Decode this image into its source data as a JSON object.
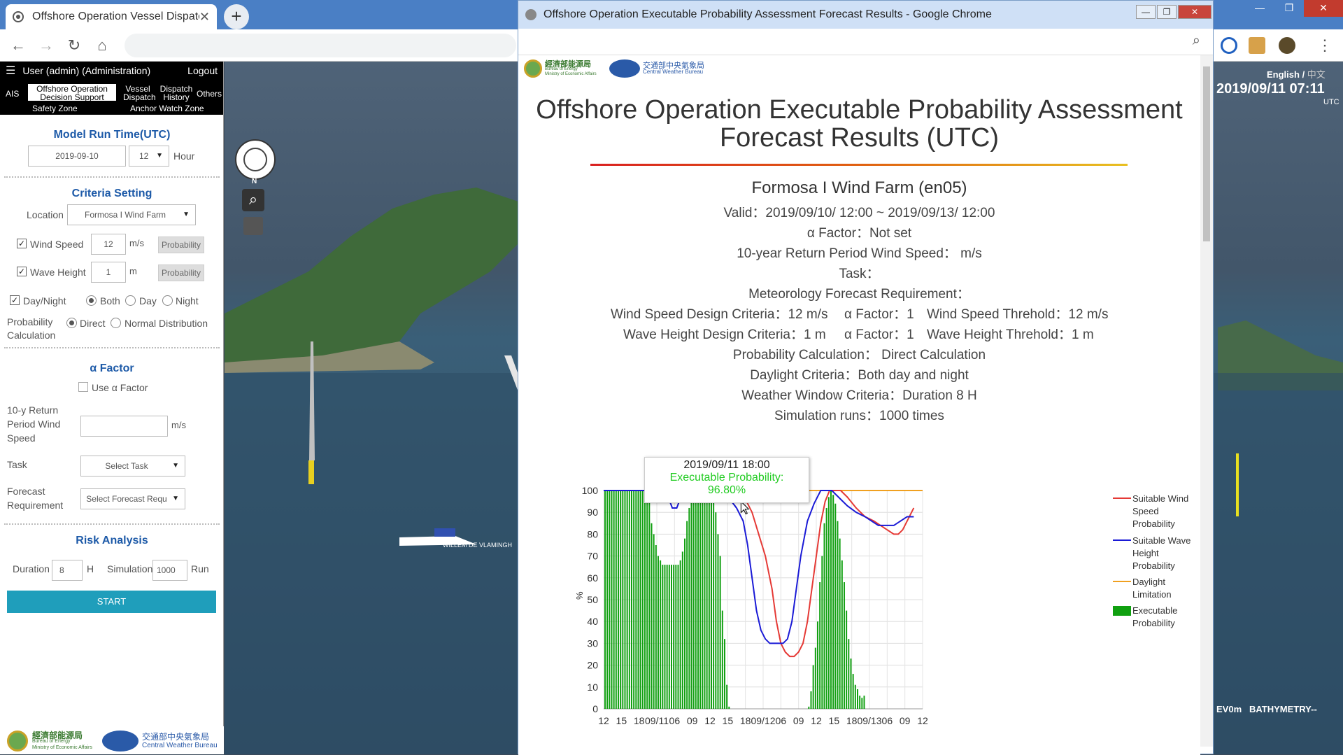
{
  "browser": {
    "tab_title": "Offshore Operation Vessel Dispatch",
    "tab_close": "✕",
    "new_tab": "+"
  },
  "sidebar": {
    "user_text": "User (admin) (Administration)",
    "logout": "Logout",
    "nav": {
      "ais": "AIS",
      "offshore_l1": "Offshore Operation",
      "offshore_l2": "Decision Support",
      "vessel_l1": "Vessel",
      "vessel_l2": "Dispatch",
      "dispatch_l1": "Dispatch",
      "dispatch_l2": "History",
      "others": "Others",
      "safety_zone": "Safety Zone",
      "anchor_watch": "Anchor Watch Zone"
    },
    "model_run_title": "Model Run Time(UTC)",
    "model_date": "2019-09-10",
    "model_hour": "12",
    "hour_label": "Hour",
    "criteria_title": "Criteria Setting",
    "location_label": "Location",
    "location_value": "Formosa I Wind Farm",
    "wind_speed_label": "Wind Speed",
    "wind_speed_value": "12",
    "wind_speed_unit": "m/s",
    "wave_height_label": "Wave Height",
    "wave_height_value": "1",
    "wave_height_unit": "m",
    "probability_btn": "Probability",
    "daynight_label": "Day/Night",
    "both_label": "Both",
    "day_label": "Day",
    "night_label": "Night",
    "prob_calc_l1": "Probability",
    "prob_calc_l2": "Calculation",
    "direct_label": "Direct",
    "normal_label": "Normal Distribution",
    "alpha_title": "α Factor",
    "use_alpha_label": "Use α Factor",
    "return_l1": "10-y Return",
    "return_l2": "Period Wind",
    "return_l3": "Speed",
    "return_unit": "m/s",
    "task_label": "Task",
    "task_placeholder": "Select Task",
    "forecast_l1": "Forecast",
    "forecast_l2": "Requirement",
    "forecast_placeholder": "Select Forecast Requ",
    "risk_title": "Risk Analysis",
    "duration_label": "Duration",
    "duration_value": "8",
    "duration_unit": "H",
    "simulation_label": "Simulation",
    "simulation_value": "1000",
    "run_label": "Run",
    "start_label": "START",
    "footer_moea_cn": "經濟部能源局",
    "footer_moea_en1": "Bureau of Energy",
    "footer_moea_en2": "Ministry of Economic Affairs",
    "footer_cwb_cn": "交通部中央氣象局",
    "footer_cwb_en": "Central Weather Bureau"
  },
  "map": {
    "lang_english": "English",
    "lang_sep": " / ",
    "lang_chinese": "中文",
    "datetime": "2019/09/11 07:11",
    "utc": "UTC",
    "vessel_name": "WILLEM DE VLAMINGH",
    "layer_1": "EV0m",
    "layer_2": "BATHYMETRY--",
    "compass_n": "N"
  },
  "popup": {
    "window_title": "Offshore Operation Executable Probability Assessment Forecast Results - Google Chrome",
    "logo_moea_cn": "經濟部能源局",
    "logo_moea_en1": "Bureau of Energy",
    "logo_moea_en2": "Ministry of Economic Affairs",
    "logo_cwb_cn": "交通部中央氣象局",
    "logo_cwb_en": "Central Weather Bureau",
    "title_l1": "Offshore Operation Executable Probability Assessment",
    "title_l2": "Forecast Results (UTC)",
    "site": "Formosa I Wind Farm (en05)",
    "valid": "Valid：2019/09/10/ 12:00 ~ 2019/09/13/ 12:00",
    "alpha_factor": "α Factor：Not set",
    "return_period": "10-year Return Period Wind Speed： m/s",
    "task": "Task：",
    "met_req": "Meteorology Forecast Requirement：",
    "wind_design": "Wind Speed Design Criteria：12 m/s",
    "wind_alpha": "α Factor：1",
    "wind_threshold": "Wind Speed Threhold：12 m/s",
    "wave_design": "Wave Height Design Criteria：1 m",
    "wave_alpha": "α Factor：1",
    "wave_threshold": "Wave Height Threhold：1 m",
    "prob_calc": "Probability Calculation： Direct Calculation",
    "daylight": "Daylight Criteria：Both day and night",
    "weather_window": "Weather Window Criteria：Duration 8 H",
    "sim_runs": "Simulation runs：1000 times",
    "tooltip_date": "2019/09/11 18:00",
    "tooltip_label": "Executable Probability:",
    "tooltip_value": "96.80%"
  },
  "chart_data": {
    "type": "bar",
    "ylabel": "%",
    "ylim": [
      0,
      100
    ],
    "yticks": [
      0,
      10,
      20,
      30,
      40,
      50,
      60,
      70,
      80,
      90,
      100
    ],
    "xticks": [
      "12",
      "15",
      "18",
      "09/11",
      "06",
      "09",
      "12",
      "15",
      "18",
      "09/12",
      "06",
      "09",
      "12",
      "15",
      "18",
      "09/13",
      "06",
      "09",
      "12"
    ],
    "x_start": "2019/09/10 12:00",
    "x_end": "2019/09/13 12:00",
    "x_step_hours": 1,
    "grid": true,
    "legend_position": "right",
    "colors": {
      "wind": "#e53935",
      "wave": "#1a1ad6",
      "daylight": "#f0a020",
      "executable": "#10a010"
    },
    "series": [
      {
        "name": "Executable Probability",
        "kind": "bar",
        "values": [
          100,
          100,
          100,
          100,
          100,
          100,
          100,
          100,
          100,
          100,
          100,
          100,
          100,
          100,
          100,
          100,
          100,
          100,
          100,
          100,
          100,
          85,
          80,
          75,
          70,
          68,
          66,
          66,
          66,
          66,
          66,
          66,
          66,
          66,
          68,
          72,
          78,
          86,
          92,
          97,
          100,
          100,
          100,
          100,
          100,
          100,
          100,
          100,
          99,
          97,
          90,
          80,
          70,
          45,
          32,
          11,
          1,
          0,
          0,
          0,
          0,
          0,
          0,
          0,
          0,
          0,
          0,
          0,
          0,
          0,
          0,
          0,
          0,
          0,
          0,
          0,
          0,
          0,
          0,
          0,
          0,
          0,
          0,
          0,
          0,
          0,
          0,
          0,
          0,
          0,
          0,
          0,
          1,
          8,
          20,
          28,
          40,
          58,
          70,
          85,
          92,
          97,
          100,
          98,
          94,
          86,
          78,
          68,
          58,
          45,
          32,
          23,
          16,
          11,
          9,
          6,
          5,
          6,
          0,
          0,
          0,
          0,
          0,
          0,
          0,
          0,
          0,
          0,
          0,
          0,
          0,
          0,
          0,
          0,
          0,
          0,
          0,
          0,
          0,
          0,
          0,
          0,
          0,
          0,
          0,
          0,
          0,
          0,
          0
        ]
      },
      {
        "name": "Suitable Wind Speed Probability",
        "kind": "line",
        "points": [
          [
            36,
            100
          ],
          [
            51,
            100
          ],
          [
            57,
            98
          ],
          [
            64,
            96
          ],
          [
            67,
            90
          ],
          [
            70,
            80
          ],
          [
            73,
            70
          ],
          [
            76,
            55
          ],
          [
            78,
            40
          ],
          [
            80,
            30
          ],
          [
            82,
            26
          ],
          [
            84,
            24
          ],
          [
            86,
            24
          ],
          [
            88,
            26
          ],
          [
            90,
            30
          ],
          [
            92,
            40
          ],
          [
            94,
            55
          ],
          [
            96,
            70
          ],
          [
            98,
            85
          ],
          [
            100,
            95
          ],
          [
            102,
            100
          ],
          [
            107,
            100
          ],
          [
            110,
            97
          ],
          [
            114,
            92
          ],
          [
            118,
            88
          ],
          [
            122,
            86
          ],
          [
            125,
            84
          ],
          [
            128,
            82
          ],
          [
            131,
            80
          ],
          [
            133,
            80
          ],
          [
            135,
            82
          ],
          [
            137,
            86
          ],
          [
            139,
            90
          ],
          [
            140,
            92
          ]
        ]
      },
      {
        "name": "Suitable Wave Height Probability",
        "kind": "line",
        "points": [
          [
            0,
            100
          ],
          [
            28,
            100
          ],
          [
            31,
            92
          ],
          [
            33,
            92
          ],
          [
            36,
            100
          ],
          [
            51,
            100
          ],
          [
            54,
            98
          ],
          [
            57,
            96
          ],
          [
            60,
            92
          ],
          [
            63,
            86
          ],
          [
            65,
            75
          ],
          [
            67,
            60
          ],
          [
            69,
            45
          ],
          [
            71,
            36
          ],
          [
            73,
            32
          ],
          [
            75,
            30
          ],
          [
            77,
            30
          ],
          [
            79,
            30
          ],
          [
            81,
            30
          ],
          [
            83,
            32
          ],
          [
            85,
            40
          ],
          [
            87,
            55
          ],
          [
            89,
            70
          ],
          [
            92,
            86
          ],
          [
            95,
            94
          ],
          [
            98,
            100
          ],
          [
            103,
            100
          ],
          [
            107,
            96
          ],
          [
            110,
            93
          ],
          [
            114,
            90
          ],
          [
            118,
            88
          ],
          [
            121,
            86
          ],
          [
            124,
            84
          ],
          [
            128,
            84
          ],
          [
            131,
            84
          ],
          [
            134,
            86
          ],
          [
            137,
            88
          ],
          [
            140,
            88
          ]
        ]
      },
      {
        "name": "Daylight Limitation",
        "kind": "line",
        "points": [
          [
            0,
            100
          ],
          [
            144,
            100
          ]
        ]
      }
    ],
    "legend_labels": {
      "wind_l1": "Suitable Wind",
      "wind_l2": "Speed",
      "wind_l3": "Probability",
      "wave_l1": "Suitable Wave",
      "wave_l2": "Height",
      "wave_l3": "Probability",
      "daylight_l1": "Daylight",
      "daylight_l2": "Limitation",
      "exec_l1": "Executable",
      "exec_l2": "Probability"
    }
  }
}
